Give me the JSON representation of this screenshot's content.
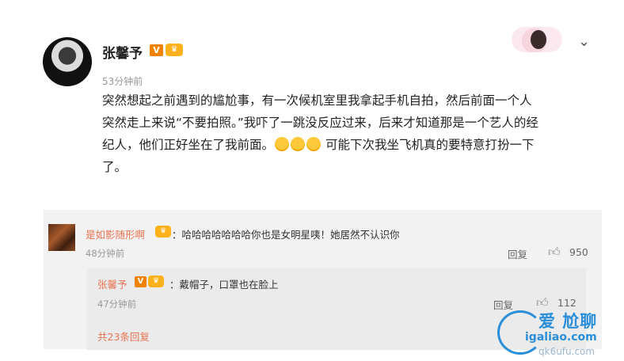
{
  "post": {
    "author": "张馨予",
    "verified_badge": "V",
    "member_icon": "crown-icon",
    "time": "53分钟前",
    "lines": [
      "突然想起之前遇到的尴尬事，有一次候机室里我拿起手机自拍，然后前面一个人",
      "突然走上来说“不要拍照。”我吓了一跳没反应过来，后来才知道那是一个艺人的经",
      "纪人，他们正好坐在了我前面。",
      "可能下次我坐飞机真的要特意打扮一下",
      "了。"
    ],
    "emoji": "sweat-smile-emoji"
  },
  "comment": {
    "name": "是如影随形啊",
    "text": "：哈哈哈哈哈哈哈你也是女明星咦！她居然不认识你",
    "time": "48分钟前",
    "reply_label": "回复",
    "likes": "950"
  },
  "reply": {
    "name": "张馨予",
    "verified_badge": "V",
    "text": "：戴帽子，口罩也在脸上",
    "time": "47分钟前",
    "reply_label": "回复",
    "likes": "112",
    "total_replies": "共23条回复"
  },
  "watermark": {
    "title": "爱 尬聊",
    "url1": "igaliao.com",
    "url2": "qk6ufu.com"
  },
  "colors": {
    "name": "#eb7350",
    "badge": "#f08200",
    "watermark": "#2a8fd8"
  }
}
